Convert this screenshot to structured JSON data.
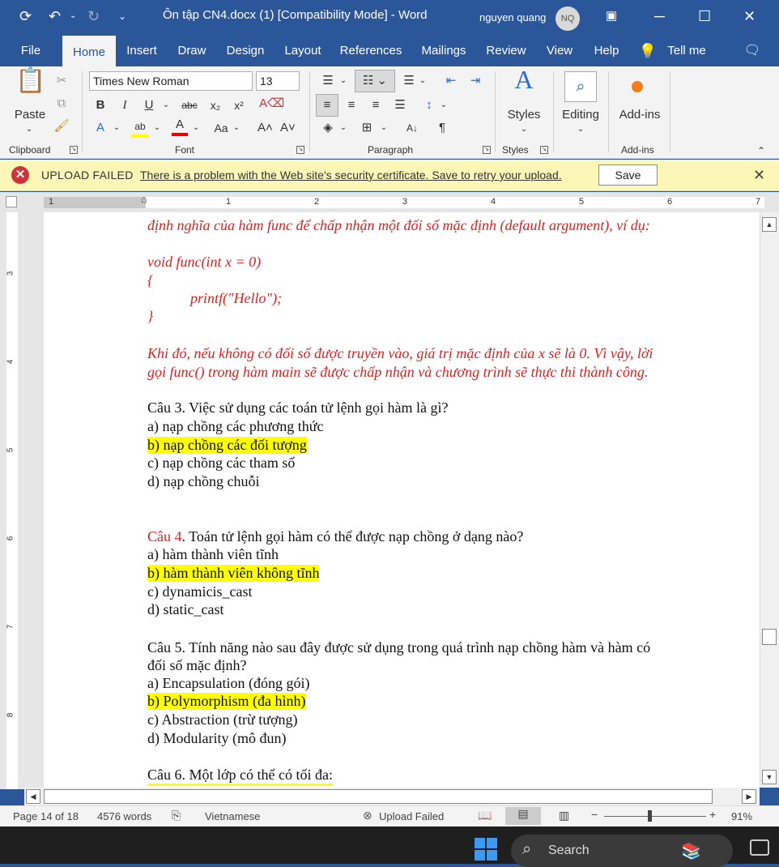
{
  "titlebar": {
    "doc_title": "Ôn tập CN4.docx (1) [Compatibility Mode]  -  Word",
    "user_name": "nguyen quang",
    "user_initials": "NQ"
  },
  "tabs": [
    "File",
    "Home",
    "Insert",
    "Draw",
    "Design",
    "Layout",
    "References",
    "Mailings",
    "Review",
    "View",
    "Help"
  ],
  "tell_me": "Tell me",
  "ribbon": {
    "paste_label": "Paste",
    "clipboard_label": "Clipboard",
    "font_name": "Times New Roman",
    "font_size": "13",
    "font_label": "Font",
    "paragraph_label": "Paragraph",
    "styles_btn": "Styles",
    "styles_label": "Styles",
    "editing_btn": "Editing",
    "addins_btn": "Add-ins",
    "addins_label": "Add-ins"
  },
  "message_bar": {
    "title": "UPLOAD FAILED",
    "text": "There is a problem with the Web site's security certificate. Save to retry your upload.",
    "save_button": "Save"
  },
  "ruler_numbers": [
    "1",
    "1",
    "2",
    "3",
    "4",
    "5",
    "6",
    "7"
  ],
  "vruler_numbers": [
    "3",
    "4",
    "5",
    "6",
    "7",
    "8"
  ],
  "document": {
    "lines": [
      {
        "text": "định nghĩa của hàm func để chấp nhận một đối số mặc định (default argument), ví dụ:",
        "style": "red"
      },
      {
        "text": "void func(int x = 0)",
        "style": "red"
      },
      {
        "text": "{",
        "style": "red"
      },
      {
        "text": "printf(\"Hello\");",
        "style": "red"
      },
      {
        "text": "}",
        "style": "red"
      },
      {
        "text": "Khi đó, nếu không có đối số được truyền vào, giá trị mặc định của x sẽ là 0. Vì vậy, lời",
        "style": "red"
      },
      {
        "text": "gọi func() trong hàm main sẽ được chấp nhận và chương trình sẽ thực thi thành công.",
        "style": "red"
      },
      {
        "text": "Câu 3.  Việc sử dụng các toán tử lệnh gọi hàm là gì?",
        "style": "normal"
      },
      {
        "text": "a) nạp chồng các phương thức",
        "style": "normal"
      },
      {
        "text": "b) nạp chồng các đối tượng",
        "style": "hl"
      },
      {
        "text": "c) nạp chồng các tham số",
        "style": "normal"
      },
      {
        "text": "d) nạp chồng chuỗi",
        "style": "normal"
      },
      {
        "text": ". Toán tử lệnh gọi hàm có thể được nạp chồng ở dạng nào?",
        "style": "normal",
        "prefix": "Câu 4"
      },
      {
        "text": "a) hàm thành viên tĩnh",
        "style": "normal"
      },
      {
        "text": "b) hàm thành viên không tĩnh",
        "style": "hl"
      },
      {
        "text": "c) dynamicis_cast",
        "style": "normal"
      },
      {
        "text": "d) static_cast",
        "style": "normal"
      },
      {
        "text": "Câu 5. Tính năng nào sau đây được sử dụng trong quá trình nạp chồng hàm và hàm có",
        "style": "normal"
      },
      {
        "text": "đối số mặc định?",
        "style": "normal"
      },
      {
        "text": "a) Encapsulation (đóng gói)",
        "style": "normal"
      },
      {
        "text": "b) Polymorphism (đa hình)",
        "style": "hl"
      },
      {
        "text": "c) Abstraction (trừ tượng)",
        "style": "normal"
      },
      {
        "text": "d) Modularity (mô đun)",
        "style": "normal"
      },
      {
        "text": "Câu 6. Một lớp có thể có tối đa:",
        "style": "normal"
      }
    ]
  },
  "status": {
    "page": "Page 14 of 18",
    "words": "4576 words",
    "language": "Vietnamese",
    "upload": "Upload Failed",
    "zoom": "91%"
  },
  "taskbar": {
    "search_text": "Search"
  },
  "colors": {
    "brand": "#2b579a",
    "answer_red": "#e02020",
    "highlight": "#ffff00",
    "error": "#d13438"
  }
}
